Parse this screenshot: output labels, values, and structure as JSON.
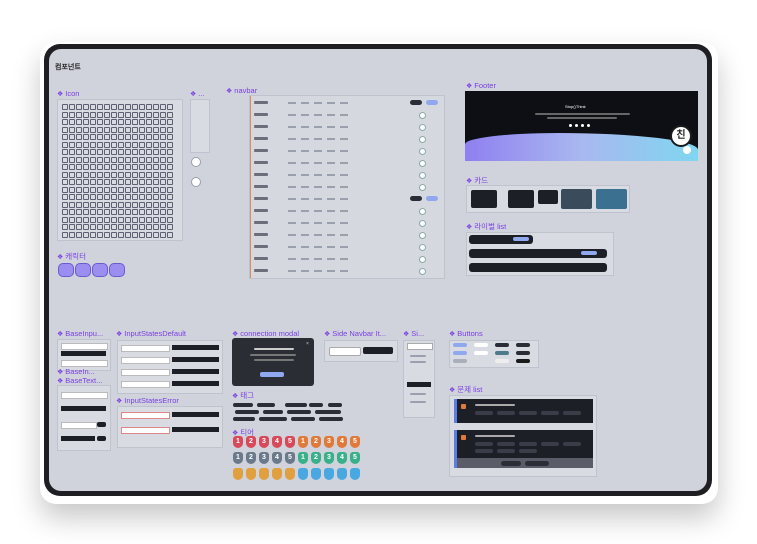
{
  "page_title": "컴포넌트",
  "sections": {
    "icon": "Icon",
    "dots": "...",
    "character": "캐릭터",
    "navbar": "navbar",
    "footer": "Footer",
    "card": "카드",
    "rival_list": "라이벌 list",
    "base_input": "BaseInpu...",
    "input_states_default": "InputStatesDefault",
    "base_label": "BaseIn...",
    "base_text": "BaseText...",
    "input_states_error": "InputStatesError",
    "connection_modal": "connection modal",
    "tag": "태그",
    "tier": "티어",
    "side_navbar": "Side Navbar It...",
    "si": "Si...",
    "buttons": "Buttons",
    "problem_list": "문제 list"
  },
  "footer": {
    "brand": "Stop()Think",
    "avatar_char": "친"
  },
  "tiers": {
    "row1": [
      "1",
      "2",
      "3",
      "4",
      "5",
      "1",
      "2",
      "3",
      "4",
      "5"
    ],
    "row2": [
      "1",
      "2",
      "3",
      "4",
      "5",
      "1",
      "2",
      "3",
      "4",
      "5"
    ]
  },
  "colors": {
    "accent": "#7a3fe0",
    "frame": "#1f1f23",
    "canvas": "#d0d3dc"
  }
}
